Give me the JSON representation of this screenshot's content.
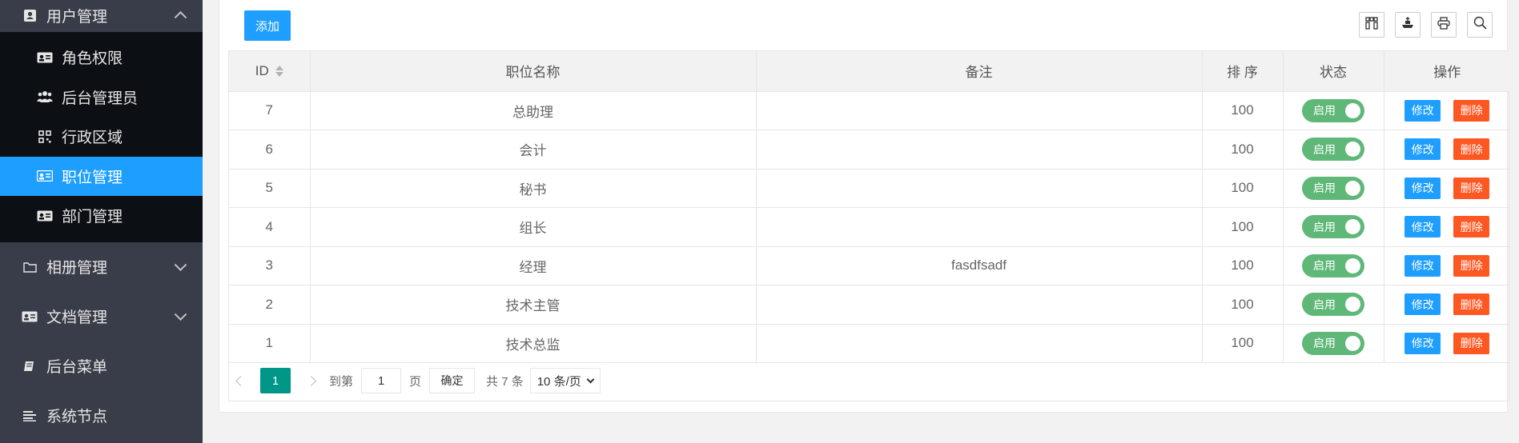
{
  "sidebar": {
    "user_mgmt": {
      "label": "用户管理",
      "icon": "user-card-icon"
    },
    "sub_items": [
      {
        "label": "角色权限",
        "icon": "id-card-icon"
      },
      {
        "label": "后台管理员",
        "icon": "users-icon"
      },
      {
        "label": "行政区域",
        "icon": "qrcode-icon"
      },
      {
        "label": "职位管理",
        "icon": "id-card-icon",
        "active": true
      },
      {
        "label": "部门管理",
        "icon": "id-card-icon"
      }
    ],
    "album": {
      "label": "相册管理",
      "icon": "folder-icon"
    },
    "docs": {
      "label": "文档管理",
      "icon": "id-card-icon"
    },
    "menu": {
      "label": "后台菜单",
      "icon": "book-icon"
    },
    "nodes": {
      "label": "系统节点",
      "icon": "align-left-icon"
    }
  },
  "toolbar": {
    "add_label": "添加",
    "tools": [
      "columns-icon",
      "export-icon",
      "print-icon",
      "search-icon"
    ]
  },
  "table": {
    "headers": {
      "id": "ID",
      "name": "职位名称",
      "remark": "备注",
      "sort": "排 序",
      "status": "状态",
      "ops": "操作"
    },
    "rows": [
      {
        "id": "7",
        "name": "总助理",
        "remark": "",
        "sort": "100",
        "status": "启用",
        "edit": "修改",
        "del": "删除"
      },
      {
        "id": "6",
        "name": "会计",
        "remark": "",
        "sort": "100",
        "status": "启用",
        "edit": "修改",
        "del": "删除"
      },
      {
        "id": "5",
        "name": "秘书",
        "remark": "",
        "sort": "100",
        "status": "启用",
        "edit": "修改",
        "del": "删除"
      },
      {
        "id": "4",
        "name": "组长",
        "remark": "",
        "sort": "100",
        "status": "启用",
        "edit": "修改",
        "del": "删除"
      },
      {
        "id": "3",
        "name": "经理",
        "remark": "fasdfsadf",
        "sort": "100",
        "status": "启用",
        "edit": "修改",
        "del": "删除"
      },
      {
        "id": "2",
        "name": "技术主管",
        "remark": "",
        "sort": "100",
        "status": "启用",
        "edit": "修改",
        "del": "删除"
      },
      {
        "id": "1",
        "name": "技术总监",
        "remark": "",
        "sort": "100",
        "status": "启用",
        "edit": "修改",
        "del": "删除"
      }
    ]
  },
  "pager": {
    "current": "1",
    "goto_label": "到第",
    "goto_value": "1",
    "page_unit": "页",
    "confirm": "确定",
    "total": "共 7 条",
    "page_size": "10 条/页"
  },
  "colors": {
    "sidebar_bg": "#393d49",
    "submenu_bg": "#0c0f13",
    "active": "#1e9fff",
    "switch_on": "#5fb878",
    "delete": "#ff5722",
    "pager_current": "#009688"
  }
}
